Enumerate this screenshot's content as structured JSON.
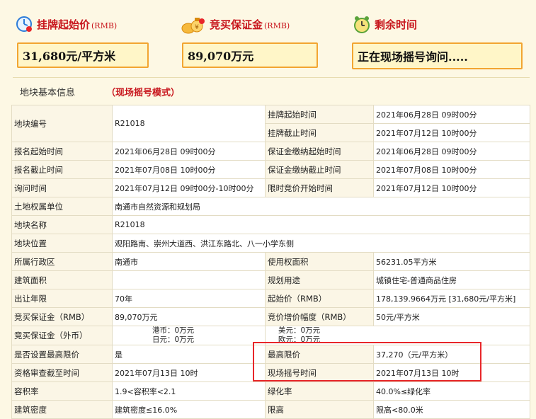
{
  "header": {
    "price_label": "挂牌起始价",
    "price_unit": "(RMB)",
    "price_value": "31,680元/平方米",
    "deposit_label": "竞买保证金",
    "deposit_unit": "(RMB)",
    "deposit_value": "89,070万元",
    "time_label": "剩余时间",
    "time_value": "正在现场摇号询问....."
  },
  "section": {
    "title": "地块基本信息",
    "mode": "（现场摇号模式）"
  },
  "table": {
    "r1": {
      "k1": "地块编号",
      "v1": "R21018",
      "k2": "挂牌起始时间",
      "v2": "2021年06月28日 09时00分"
    },
    "r1b": {
      "k2": "挂牌截止时间",
      "v2": "2021年07月12日 10时00分"
    },
    "r2": {
      "k1": "报名起始时间",
      "v1": "2021年06月28日 09时00分",
      "k2": "保证金缴纳起始时间",
      "v2": "2021年06月28日 09时00分"
    },
    "r3": {
      "k1": "报名截止时间",
      "v1": "2021年07月08日 10时00分",
      "k2": "保证金缴纳截止时间",
      "v2": "2021年07月08日 10时00分"
    },
    "r4": {
      "k1": "询问时间",
      "v1": "2021年07月12日 09时00分-10时00分",
      "k2": "限时竞价开始时间",
      "v2": "2021年07月12日 10时00分"
    },
    "r5": {
      "k1": "土地权属单位",
      "v1": "南通市自然资源和规划局"
    },
    "r6": {
      "k1": "地块名称",
      "v1": "R21018"
    },
    "r7": {
      "k1": "地块位置",
      "v1": "观阳路南、崇州大道西、洪江东路北、八一小学东侧"
    },
    "r8": {
      "k1": "所属行政区",
      "v1": "南通市",
      "k2": "使用权面积",
      "v2": "56231.05平方米"
    },
    "r9": {
      "k1": "建筑面积",
      "v1": "",
      "k2": "规划用途",
      "v2": "城镇住宅-普通商品住房"
    },
    "r10": {
      "k1": "出让年限",
      "v1": "70年",
      "k2": "起始价（RMB）",
      "v2": "178,139.9664万元 [31,680元/平方米]"
    },
    "r11": {
      "k1": "竞买保证金（RMB）",
      "v1": "89,070万元",
      "k2": "竞价增价幅度（RMB）",
      "v2": "50元/平方米"
    },
    "r12": {
      "k1": "竞买保证金（外币）",
      "hk": "港币：0万元",
      "jp": "日元：0万元",
      "us": "美元：0万元",
      "eu": "欧元：0万元"
    },
    "r13": {
      "k1": "是否设置最高限价",
      "v1": "是",
      "k2": "最高限价",
      "v2": "37,270（元/平方米）"
    },
    "r14": {
      "k1": "资格审查截至时间",
      "v1": "2021年07月13日 10时",
      "k2": "现场摇号时间",
      "v2": "2021年07月13日 10时"
    },
    "r15": {
      "k1": "容积率",
      "v1": "1.9<容积率<2.1",
      "k2": "绿化率",
      "v2": "40.0%≤绿化率"
    },
    "r16": {
      "k1": "建筑密度",
      "v1": "建筑密度≤16.0%",
      "k2": "限高",
      "v2": "限高<80.0米"
    }
  }
}
